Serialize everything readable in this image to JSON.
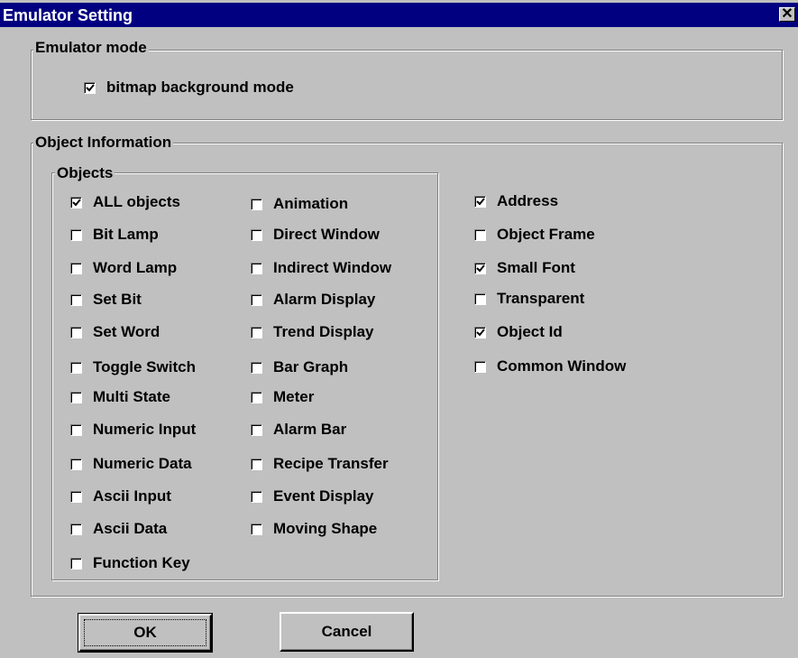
{
  "window": {
    "title": "Emulator Setting"
  },
  "emulator_mode": {
    "legend": "Emulator mode",
    "bitmap_background": {
      "label": "bitmap background mode",
      "checked": true
    }
  },
  "object_information": {
    "legend": "Object Information",
    "objects_legend": "Objects",
    "objects_col1": [
      {
        "label": "ALL objects",
        "checked": true
      },
      {
        "label": "Bit Lamp",
        "checked": false
      },
      {
        "label": "Word Lamp",
        "checked": false
      },
      {
        "label": "Set Bit",
        "checked": false
      },
      {
        "label": "Set Word",
        "checked": false
      },
      {
        "label": "Toggle Switch",
        "checked": false
      },
      {
        "label": "Multi State",
        "checked": false
      },
      {
        "label": "Numeric Input",
        "checked": false
      },
      {
        "label": "Numeric Data",
        "checked": false
      },
      {
        "label": "Ascii Input",
        "checked": false
      },
      {
        "label": "Ascii Data",
        "checked": false
      },
      {
        "label": "Function Key",
        "checked": false
      }
    ],
    "objects_col2": [
      {
        "label": "Animation",
        "checked": false
      },
      {
        "label": "Direct Window",
        "checked": false
      },
      {
        "label": "Indirect Window",
        "checked": false
      },
      {
        "label": "Alarm Display",
        "checked": false
      },
      {
        "label": "Trend Display",
        "checked": false
      },
      {
        "label": "Bar Graph",
        "checked": false
      },
      {
        "label": "Meter",
        "checked": false
      },
      {
        "label": "Alarm Bar",
        "checked": false
      },
      {
        "label": "Recipe Transfer",
        "checked": false
      },
      {
        "label": "Event Display",
        "checked": false
      },
      {
        "label": "Moving Shape",
        "checked": false
      }
    ],
    "options": [
      {
        "label": "Address",
        "checked": true
      },
      {
        "label": "Object Frame",
        "checked": false
      },
      {
        "label": "Small Font",
        "checked": true
      },
      {
        "label": "Transparent",
        "checked": false
      },
      {
        "label": "Object Id",
        "checked": true
      },
      {
        "label": "Common Window",
        "checked": false
      }
    ]
  },
  "buttons": {
    "ok": "OK",
    "cancel": "Cancel"
  }
}
